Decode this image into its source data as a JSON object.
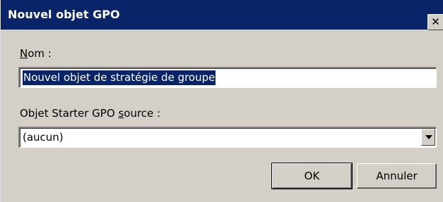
{
  "window": {
    "title": "Nouvel objet GPO",
    "close_glyph": "✕"
  },
  "form": {
    "name_label_accel": "N",
    "name_label_rest": "om :",
    "name_value": "Nouvel objet de stratégie de groupe",
    "starter_label_prefix": "Objet Starter GPO ",
    "starter_label_accel": "s",
    "starter_label_rest": "ource :",
    "starter_selected": "(aucun)"
  },
  "buttons": {
    "ok_label": "OK",
    "cancel_label": "Annuler"
  },
  "colors": {
    "titlebar": "#0a246a",
    "dialog_bg": "#d4d0c8",
    "selection": "#0a246a"
  }
}
